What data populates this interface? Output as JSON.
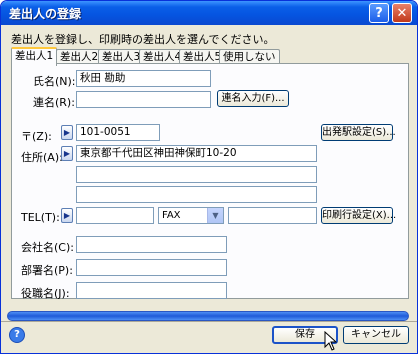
{
  "window": {
    "title": "差出人の登録",
    "help_glyph": "?",
    "close_glyph": "✕"
  },
  "intro": "差出人を登録し、印刷時の差出人を選んでください。",
  "tabs": [
    "差出人1",
    "差出人2",
    "差出人3",
    "差出人4",
    "差出人5",
    "使用しない"
  ],
  "form": {
    "name_label": "氏名(N):",
    "name_value": "秋田  勘助",
    "joint_name_label": "連名(R):",
    "joint_name_value": "",
    "joint_name_button": "連名入力(F)...",
    "zip_label": "〒(Z):",
    "zip_value": "101-0051",
    "origin_station_button": "出発駅設定(S)...",
    "address_label": "住所(A):",
    "address_lines": [
      "東京都千代田区神田神保町10-20",
      "",
      ""
    ],
    "tel_label": "TEL(T):",
    "tel_value": "",
    "fax_select": "FAX",
    "fax_value": "",
    "print_lines_button": "印刷行設定(X)...",
    "company_label": "会社名(C):",
    "company_value": "",
    "department_label": "部署名(P):",
    "department_value": "",
    "title_label": "役職名(J):",
    "title_value": ""
  },
  "footer": {
    "save_button": "保存",
    "cancel_button": "キャンセル"
  },
  "icons": {
    "arrow": "▶",
    "dropdown": "▼",
    "help": "?"
  },
  "colors": {
    "titlebar": "#0554e0",
    "dialog_bg": "#ece9d8",
    "active_tab_accent": "#ffc83c",
    "progress": "#1f5bd8"
  }
}
